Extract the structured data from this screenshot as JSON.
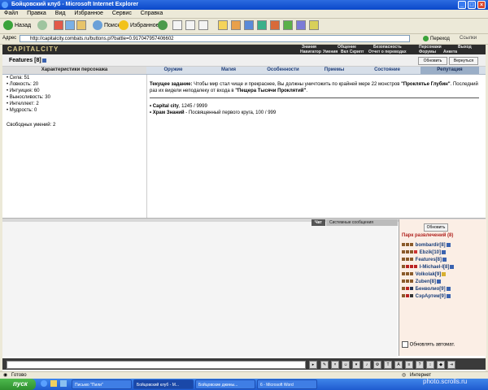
{
  "window": {
    "title": "Бойцовский клуб - Microsoft Internet Explorer"
  },
  "menu": [
    "Файл",
    "Правка",
    "Вид",
    "Избранное",
    "Сервис",
    "Справка"
  ],
  "toolbar": {
    "back": "Назад",
    "search": "Поиск",
    "favorites": "Избранное"
  },
  "address": {
    "label": "Адрес",
    "url": "http://capitalcity.combats.ru/buttons.pl?battle=0.917047957406602",
    "go": "Переход",
    "links": "Ссылки"
  },
  "game": {
    "logo": "CAPITALCITY",
    "nav_top": [
      "Знания",
      "Общение",
      "Безопасность",
      "Персонажи",
      "Выход"
    ],
    "nav_bottom": [
      "Навигатор",
      "Умения",
      "Вкл Скрипт",
      "Отчет о переводах",
      "Форумы",
      "Анкета"
    ],
    "character": {
      "name": "Features",
      "level": "[8]"
    },
    "buttons": {
      "refresh": "Обновить",
      "back": "Вернуться"
    },
    "tabs": [
      "Характеристики персонажа",
      "Оружие",
      "Магия",
      "Особенности",
      "Приемы",
      "Состояние",
      "Репутация"
    ],
    "stats": [
      "• Сила: 51",
      "• Ловкость: 20",
      "• Интуиция: 60",
      "• Выносливость: 30",
      "• Интеллект: 2",
      "• Мудрость: 0"
    ],
    "free_skills": "Свободных умений: 2",
    "quest": {
      "label": "Текущее задание:",
      "text1": " Чтобы мир стал чище и прекраснее, Вы должны уничтожить по крайней мере 22 монстров ",
      "monster": "\"Проклятье Глубин\"",
      "text2": ". Последний раз их видели неподалеку от входа в ",
      "place": "\"Пещера Тысячи Проклятий\"",
      "text3": "."
    },
    "reputation": [
      {
        "name": "• Capital city",
        "value": ", 1245 / 9999"
      },
      {
        "name": "• Храм Знаний",
        "value": " - Посвященный первого круга, 100 / 999"
      }
    ],
    "chat_tabs": [
      "Чат",
      "Системные сообщения"
    ],
    "panel": {
      "refresh": "Обновить",
      "title": "Парк развлечений (8)",
      "users": [
        "bombardir[8]",
        "Ebzik[10]",
        "Features[8]",
        "I-Michael-I[8]",
        "Volkolak[9]",
        "Zuben[8]",
        "Бенволио[9]",
        "СэрАртем[9]"
      ],
      "auto_update": "Обновлять автомат."
    }
  },
  "status": {
    "done": "Готово",
    "zone": "Интернет"
  },
  "taskbar": {
    "start": "пуск",
    "tasks": [
      "Письмо \"Пили\"",
      "Бойцовский клуб - M...",
      "Бойцовские джины...",
      "6 - Microsoft Word"
    ]
  },
  "watermark": "photo.scrolls.ru"
}
